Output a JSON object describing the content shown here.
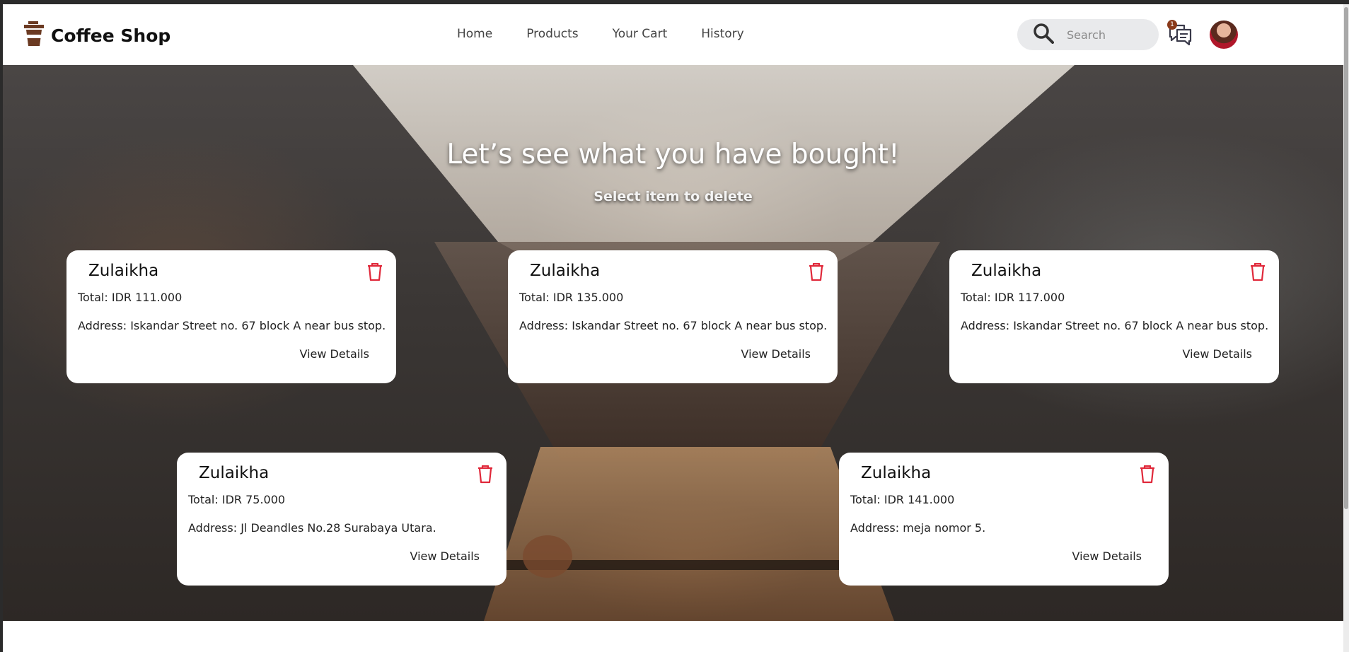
{
  "brand": {
    "title": "Coffee Shop",
    "icon": "coffee-cup-icon",
    "color": "#6b3a22"
  },
  "nav": {
    "links": [
      "Home",
      "Products",
      "Your Cart",
      "History"
    ]
  },
  "search": {
    "placeholder": "Search"
  },
  "chat": {
    "badge": "1",
    "icon": "chat-bubbles-icon"
  },
  "hero": {
    "title": "Let’s see what you have bought!",
    "subtitle": "Select item to delete"
  },
  "orders": [
    {
      "name": "Zulaikha",
      "total": "Total: IDR 111.000",
      "address": "Address: Iskandar Street no. 67 block A near bus stop.",
      "details": "View Details"
    },
    {
      "name": "Zulaikha",
      "total": "Total: IDR 135.000",
      "address": "Address: Iskandar Street no. 67 block A near bus stop.",
      "details": "View Details"
    },
    {
      "name": "Zulaikha",
      "total": "Total: IDR 117.000",
      "address": "Address: Iskandar Street no. 67 block A near bus stop.",
      "details": "View Details"
    },
    {
      "name": "Zulaikha",
      "total": "Total: IDR 75.000",
      "address": "Address: Jl Deandles No.28 Surabaya Utara.",
      "details": "View Details"
    },
    {
      "name": "Zulaikha",
      "total": "Total: IDR 141.000",
      "address": "Address: meja nomor 5.",
      "details": "View Details"
    }
  ],
  "colors": {
    "delete": "#e0283a",
    "accent": "#6b3a22"
  }
}
